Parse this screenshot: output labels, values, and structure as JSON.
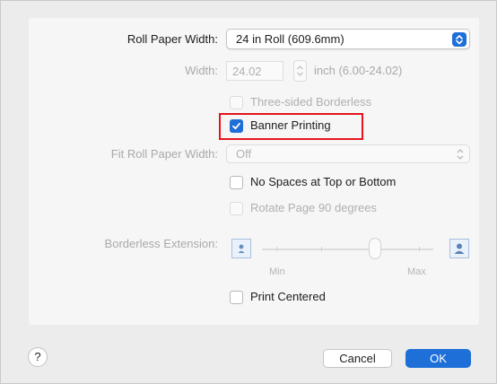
{
  "colors": {
    "accent": "#1f6fd8",
    "highlight_box": "#e5141c"
  },
  "roll_paper_width": {
    "label": "Roll Paper Width:",
    "value": "24 in Roll (609.6mm)",
    "icon": "popup-arrows-icon"
  },
  "width": {
    "label": "Width:",
    "value": "24.02",
    "unit_range": "inch (6.00-24.02)",
    "icon": "stepper-icon"
  },
  "three_sided": {
    "label": "Three-sided Borderless",
    "checked": false,
    "enabled": false
  },
  "banner_printing": {
    "label": "Banner Printing",
    "checked": true,
    "enabled": true
  },
  "fit_roll": {
    "label": "Fit Roll Paper Width:",
    "value": "Off",
    "icon": "popup-arrows-icon"
  },
  "no_spaces": {
    "label": "No Spaces at Top or Bottom",
    "checked": false,
    "enabled": true
  },
  "rotate": {
    "label": "Rotate Page 90 degrees",
    "checked": false,
    "enabled": false
  },
  "borderless_extension": {
    "label": "Borderless Extension:",
    "min_label": "Min",
    "max_label": "Max",
    "level": 0.67,
    "icons": [
      "person-small-icon",
      "person-large-icon"
    ]
  },
  "print_centered": {
    "label": "Print Centered",
    "checked": false,
    "enabled": true
  },
  "footer": {
    "help_label": "?",
    "cancel_label": "Cancel",
    "ok_label": "OK"
  }
}
